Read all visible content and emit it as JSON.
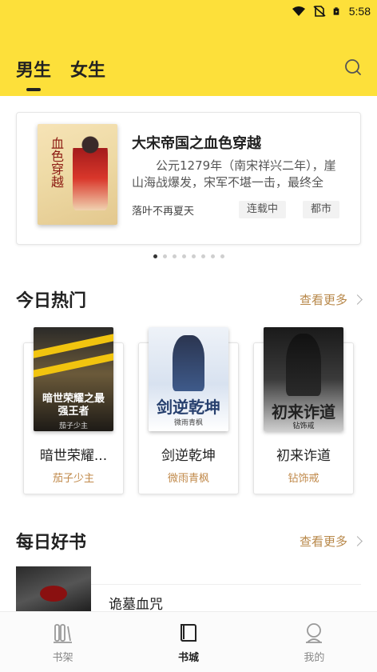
{
  "status_bar": {
    "time": "5:58",
    "icons": [
      "wifi-icon",
      "no-sim-icon",
      "battery-icon"
    ]
  },
  "header": {
    "tabs": [
      {
        "label": "男生",
        "active": true
      },
      {
        "label": "女生",
        "active": false
      }
    ],
    "search_icon": "search-icon",
    "background": "#fde03a"
  },
  "banner": {
    "title": "大宋帝国之血色穿越",
    "description": "公元1279年（南宋祥兴二年），崖山海战爆发，宋军不堪一击，最终全",
    "author": "落叶不再夏天",
    "tags": [
      "连载中",
      "都市"
    ],
    "cover_text": "血色穿越",
    "page_count": 8,
    "active_page": 1
  },
  "hot_section": {
    "title": "今日热门",
    "more_label": "查看更多",
    "books": [
      {
        "title": "暗世荣耀...",
        "author": "茄子少主",
        "cover_text": "暗世荣耀之最强王者",
        "cover_sub": "茄子少主"
      },
      {
        "title": "剑逆乾坤",
        "author": "微雨青枫",
        "cover_text": "剑逆乾坤",
        "cover_sub": "微雨青枫"
      },
      {
        "title": "初来诈道",
        "author": "钻饰戒",
        "cover_text": "初来诈道",
        "cover_sub": "钻饰戒"
      }
    ]
  },
  "daily_section": {
    "title": "每日好书",
    "more_label": "查看更多",
    "books": [
      {
        "title": "诡墓血咒"
      }
    ]
  },
  "bottom_nav": {
    "items": [
      {
        "label": "书架",
        "icon": "bookshelf-icon",
        "active": false
      },
      {
        "label": "书城",
        "icon": "book-store-icon",
        "active": true
      },
      {
        "label": "我的",
        "icon": "profile-icon",
        "active": false
      }
    ]
  },
  "colors": {
    "accent_yellow": "#fde03a",
    "author_gold": "#c0894a",
    "more_link": "#b8884a"
  }
}
